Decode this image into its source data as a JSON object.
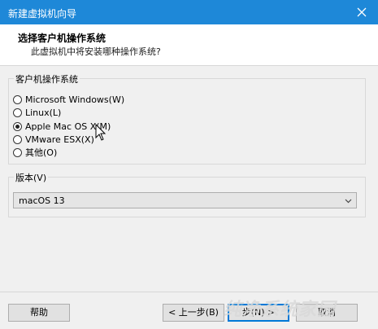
{
  "window": {
    "title": "新建虚拟机向导"
  },
  "header": {
    "title": "选择客户机操作系统",
    "subtitle": "此虚拟机中将安装哪种操作系统?"
  },
  "os_group": {
    "label": "客户机操作系统",
    "options": [
      {
        "label": "Microsoft Windows(W)",
        "selected": false
      },
      {
        "label": "Linux(L)",
        "selected": false
      },
      {
        "label": "Apple Mac OS X(M)",
        "selected": true
      },
      {
        "label": "VMware ESX(X)",
        "selected": false
      },
      {
        "label": "其他(O)",
        "selected": false
      }
    ]
  },
  "version_group": {
    "label": "版本(V)",
    "selected": "macOS 13"
  },
  "footer": {
    "help": "帮助",
    "back": "< 上一步(B)",
    "next": "步(N) >",
    "cancel": "取消"
  },
  "watermark": "纯净系统家园"
}
